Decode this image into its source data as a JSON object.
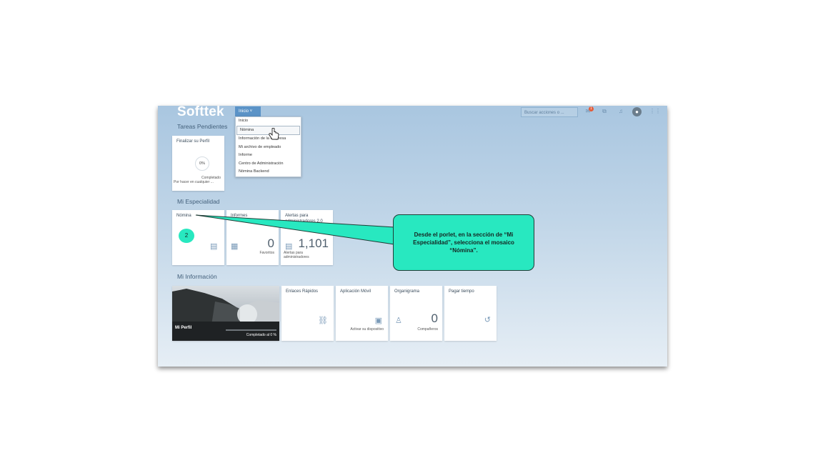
{
  "header": {
    "logo": "Softtek",
    "menu_button_label": "Inicio ˅",
    "search_placeholder": "Buscar acciones o ...",
    "notification_badge": "1",
    "icons": [
      "notification-icon",
      "copy-icon",
      "bell-icon",
      "avatar",
      "grid-icon"
    ]
  },
  "dropdown": {
    "items": [
      "Inicio",
      "Nómina",
      "Información de la empresa",
      "Mi archivo de empleado",
      "Informe",
      "Centro de Administración",
      "Nómina Backend"
    ],
    "selected_index": 1
  },
  "sections": {
    "pending": "Tareas Pendientes",
    "specialty": "Mi Especialidad",
    "info": "Mi Información"
  },
  "profile_task": {
    "title": "Finalizar su Perfil",
    "progress_percent": "0%",
    "status": "Completado",
    "footer": "Por hacer en cualquier ..."
  },
  "specialty_tiles": {
    "nomina": {
      "title": "Nómina"
    },
    "informes": {
      "title": "Informes",
      "value": "0",
      "sub": "Favoritos"
    },
    "alertas": {
      "title": "Alertas para administradores 2.0",
      "value": "1,101",
      "sub": "Alertas para administradores"
    }
  },
  "info_tiles": {
    "perfil": {
      "title": "Mi Perfil",
      "progress": "Completado al 0 %",
      "progress_fraction": 0
    },
    "enlaces": {
      "title": "Enlaces Rápidos"
    },
    "movil": {
      "title": "Aplicación Móvil",
      "sub": "Activar su dispositivo"
    },
    "organigrama": {
      "title": "Organigrama",
      "value": "0",
      "sub": "Compañeros"
    },
    "pagar": {
      "title": "Pagar tiempo"
    }
  },
  "callout": {
    "text": "Desde el porlet, en la sección de “Mi Especialidad”, selecciona el mosaico “Nómina”.",
    "step": "2"
  },
  "colors": {
    "accent": "#28e8c0",
    "header_blue": "#5b93c7",
    "background_top": "#a9c6e0"
  }
}
